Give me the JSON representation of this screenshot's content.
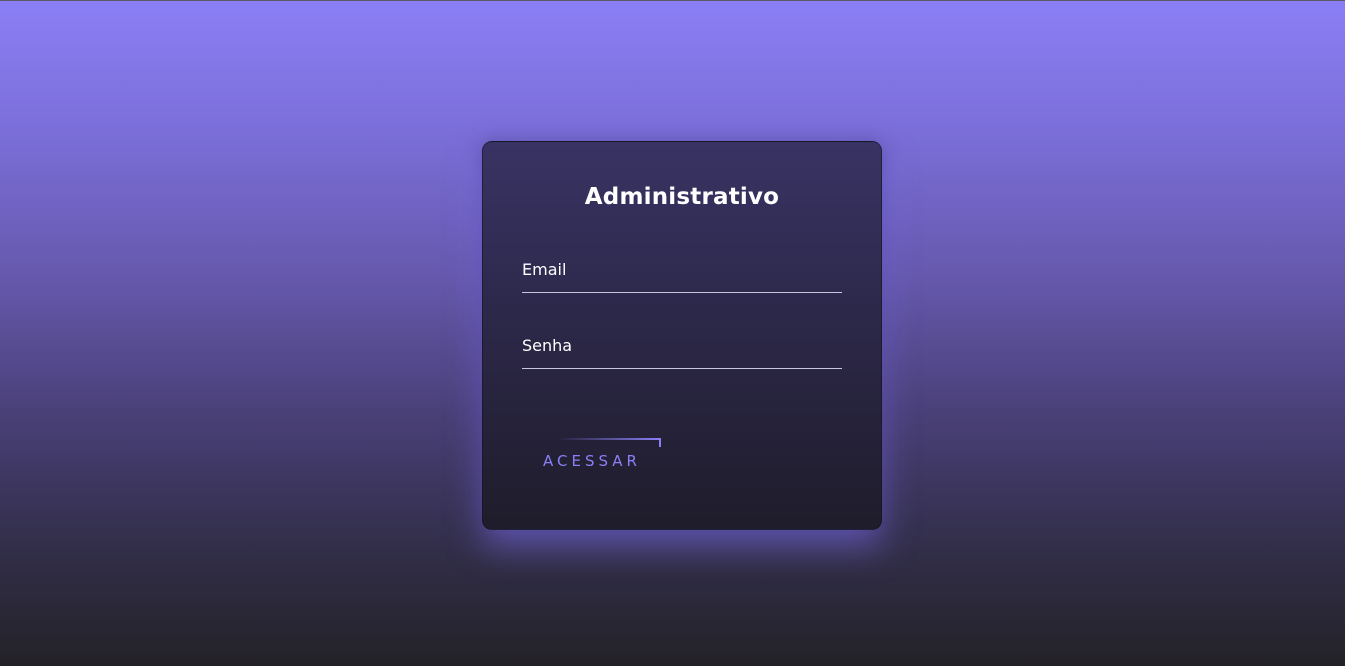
{
  "login": {
    "title": "Administrativo",
    "email_label": "Email",
    "password_label": "Senha",
    "submit_label": "ACESSAR"
  },
  "colors": {
    "accent": "#8a7ff5",
    "card_top": "#393364",
    "card_bottom": "#1f1c2b",
    "background_top": "#8a7ff5",
    "background_bottom": "#232227"
  }
}
